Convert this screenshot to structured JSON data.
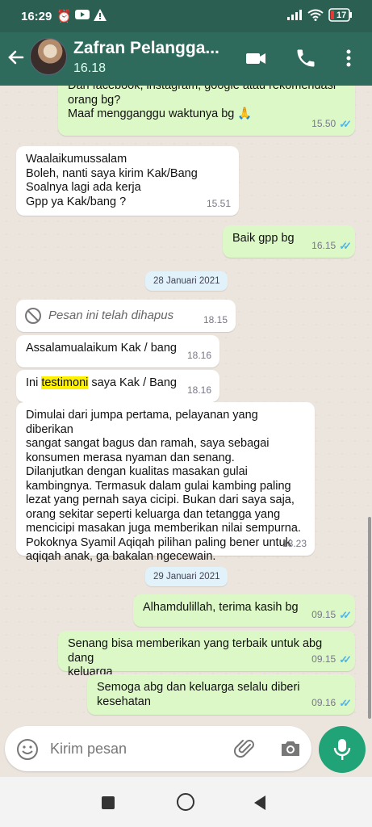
{
  "status": {
    "time": "16:29",
    "battery": "17"
  },
  "header": {
    "contact_name": "Zafran Pelangga...",
    "contact_status": "16.18"
  },
  "messages": [
    {
      "dir": "out",
      "lines": [
        "Dari facebook, instagram, google atau rekomendasi",
        "orang bg?",
        "Maaf mengganggu waktunya bg 🙏"
      ],
      "time": "15.50",
      "read": true
    },
    {
      "dir": "in",
      "lines": [
        "Waalaikumussalam",
        "Boleh, nanti saya kirim Kak/Bang",
        "Soalnya lagi ada kerja",
        "Gpp ya Kak/bang ?"
      ],
      "time": "15.51"
    },
    {
      "dir": "out",
      "lines": [
        "Baik gpp bg"
      ],
      "time": "16.15",
      "read": true
    },
    {
      "dir": "in",
      "deleted": true,
      "text": "Pesan ini telah dihapus",
      "time": "18.15"
    },
    {
      "dir": "in",
      "lines": [
        "Assalamualaikum Kak / bang"
      ],
      "time": "18.16"
    },
    {
      "dir": "in",
      "pre": "Ini ",
      "highlight": "testimoni",
      "post": " saya Kak / Bang",
      "time": "18.16"
    },
    {
      "dir": "in",
      "lines": [
        "Dimulai dari jumpa pertama, pelayanan yang diberikan",
        "sangat sangat bagus dan ramah, saya sebagai",
        "konsumen merasa nyaman dan senang.",
        "Dilanjutkan dengan kualitas masakan gulai",
        "kambingnya. Termasuk dalam gulai kambing paling",
        "lezat yang pernah saya cicipi. Bukan dari saya saja,",
        "orang sekitar seperti keluarga dan tetangga yang",
        "mencicipi masakan juga memberikan nilai sempurna.",
        "Pokoknya Syamil Aqiqah pilihan paling bener untuk",
        "aqiqah anak, ga bakalan ngecewain."
      ],
      "time": "18.23"
    },
    {
      "dir": "out",
      "lines": [
        "Alhamdulillah, terima kasih bg"
      ],
      "time": "09.15",
      "read": true
    },
    {
      "dir": "out",
      "lines": [
        "Senang bisa memberikan yang terbaik untuk abg dang",
        "keluarga"
      ],
      "time": "09.15",
      "read": true
    },
    {
      "dir": "out",
      "lines": [
        "Semoga abg dan keluarga selalu diberi kesehatan"
      ],
      "time": "09.16",
      "read": true
    }
  ],
  "dates": [
    "28 Januari 2021",
    "29 Januari 2021"
  ],
  "input": {
    "placeholder": "Kirim pesan"
  },
  "colors": {
    "header": "#2f6b5d",
    "outgoing": "#dcf8c6",
    "incoming": "#ffffff",
    "ticks": "#4fb6ec",
    "fab": "#1fa377"
  }
}
